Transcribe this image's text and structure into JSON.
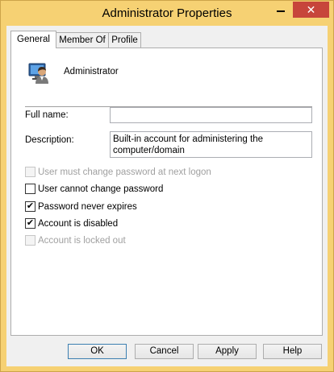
{
  "window": {
    "title": "Administrator Properties",
    "minimize_label": "—",
    "close_label": "✕"
  },
  "tabs": [
    {
      "label": "General",
      "active": true
    },
    {
      "label": "Member Of",
      "active": false
    },
    {
      "label": "Profile",
      "active": false
    }
  ],
  "general": {
    "user_icon": "user-icon",
    "user_name": "Administrator",
    "full_name_label": "Full name:",
    "full_name_value": "",
    "description_label": "Description:",
    "description_value": "Built-in account for administering the computer/domain"
  },
  "checkboxes": [
    {
      "label": "User must change password at next logon",
      "checked": false,
      "disabled": true
    },
    {
      "label": "User cannot change password",
      "checked": false,
      "disabled": false
    },
    {
      "label": "Password never expires",
      "checked": true,
      "disabled": false
    },
    {
      "label": "Account is disabled",
      "checked": true,
      "disabled": false
    },
    {
      "label": "Account is locked out",
      "checked": false,
      "disabled": true
    }
  ],
  "buttons": {
    "ok": "OK",
    "cancel": "Cancel",
    "apply": "Apply",
    "help": "Help"
  },
  "colors": {
    "frame": "#f6d173",
    "close_button": "#c7453b",
    "client": "#f0f0f0"
  }
}
